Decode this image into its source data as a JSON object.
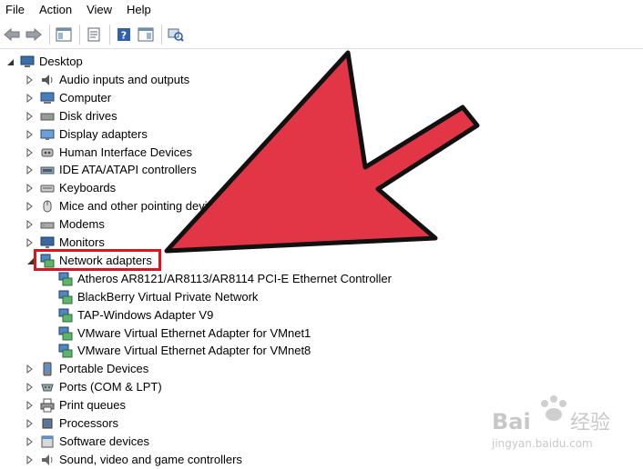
{
  "menubar": {
    "items": [
      "File",
      "Action",
      "View",
      "Help"
    ]
  },
  "toolbar": {
    "buttons": [
      "back-arrow-icon",
      "forward-arrow-icon",
      "show-hide-console-tree-icon",
      "properties-icon",
      "help-icon",
      "action-pane-icon",
      "scan-hardware-icon"
    ]
  },
  "tree": {
    "root": "Desktop",
    "categories_top": [
      "Audio inputs and outputs",
      "Computer",
      "Disk drives",
      "Display adapters",
      "Human Interface Devices",
      "IDE ATA/ATAPI controllers",
      "Keyboards",
      "Mice and other pointing devices",
      "Modems",
      "Monitors"
    ],
    "expanded_category": "Network adapters",
    "network_adapters": [
      "Atheros AR8121/AR8113/AR8114 PCI-E Ethernet Controller",
      "BlackBerry Virtual Private Network",
      "TAP-Windows Adapter V9",
      "VMware Virtual Ethernet Adapter for VMnet1",
      "VMware Virtual Ethernet Adapter for VMnet8"
    ],
    "categories_bottom": [
      "Portable Devices",
      "Ports (COM & LPT)",
      "Print queues",
      "Processors",
      "Software devices",
      "Sound, video and game controllers"
    ]
  },
  "colors": {
    "arrow_fill": "#e23545",
    "highlight": "#e0121b"
  },
  "watermark": {
    "brand": "Bai",
    "brand_cn": "经验",
    "url": "jingyan.baidu.com"
  }
}
